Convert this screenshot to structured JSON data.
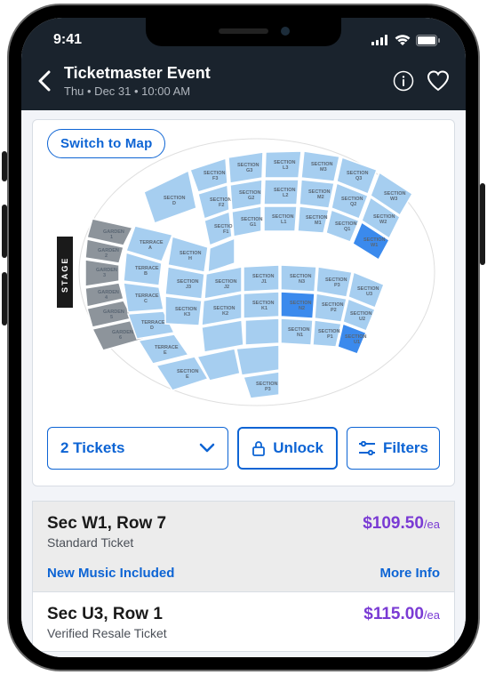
{
  "status": {
    "time": "9:41"
  },
  "header": {
    "title": "Ticketmaster Event",
    "subtitle": "Thu • Dec 31 • 10:00 AM"
  },
  "switch_map_label": "Switch to Map",
  "actions": {
    "tickets_label": "2 Tickets",
    "unlock_label": "Unlock",
    "filters_label": "Filters"
  },
  "listings": [
    {
      "seat": "Sec W1, Row 7",
      "type": "Standard Ticket",
      "price": "$109.50",
      "ea": "/ea",
      "extra1": "New Music Included",
      "extra2": "More Info",
      "highlight": true
    },
    {
      "seat": "Sec U3, Row 1",
      "type": "Verified Resale Ticket",
      "price": "$115.00",
      "ea": "/ea",
      "highlight": false
    }
  ],
  "map": {
    "stage": "STAGE",
    "sections": {
      "garden1": "GARDEN\n1",
      "garden2": "GARDEN\n2",
      "garden3": "GARDEN\n3",
      "garden4": "GARDEN\n4",
      "garden5": "GARDEN\n5",
      "garden6": "GARDEN\n6",
      "terraceA": "TERRACE\nA",
      "terraceB": "TERRACE\nB",
      "terraceC": "TERRACE\nC",
      "terraceD": "TERRACE\nD",
      "terraceE": "TERRACE\nE",
      "sectionD": "SECTION\nD",
      "sectionE": "SECTION\nE",
      "sectionF1": "SECTION\nF1",
      "sectionF2": "SECTION\nF2",
      "sectionF3": "SECTION\nF3",
      "sectionG1": "SECTION\nG1",
      "sectionG2": "SECTION\nG2",
      "sectionG3": "SECTION\nG3",
      "sectionH": "SECTION\nH",
      "sectionJ1": "SECTION\nJ1",
      "sectionJ2": "SECTION\nJ2",
      "sectionJ3": "SECTION\nJ3",
      "sectionK1": "SECTION\nK1",
      "sectionK2": "SECTION\nK2",
      "sectionK3": "SECTION\nK3",
      "sectionL1": "SECTION\nL1",
      "sectionL2": "SECTION\nL2",
      "sectionL3": "SECTION\nL3",
      "sectionM1": "SECTION\nM1",
      "sectionM2": "SECTION\nM2",
      "sectionM3": "SECTION\nM3",
      "sectionN1": "SECTION\nN1",
      "sectionN2": "SECTION\nN2",
      "sectionN3": "SECTION\nN3",
      "sectionP1": "SECTION\nP1",
      "sectionP2": "SECTION\nP2",
      "sectionP3": "SECTION\nP3",
      "sectionQ1": "SECTION\nQ1",
      "sectionQ2": "SECTION\nQ2",
      "sectionQ3": "SECTION\nQ3",
      "sectionU1": "SECTION\nU1",
      "sectionU2": "SECTION\nU2",
      "sectionU3": "SECTION\nU3",
      "sectionW1": "SECTION\nW1",
      "sectionW2": "SECTION\nW2",
      "sectionW3": "SECTION\nW3"
    }
  }
}
